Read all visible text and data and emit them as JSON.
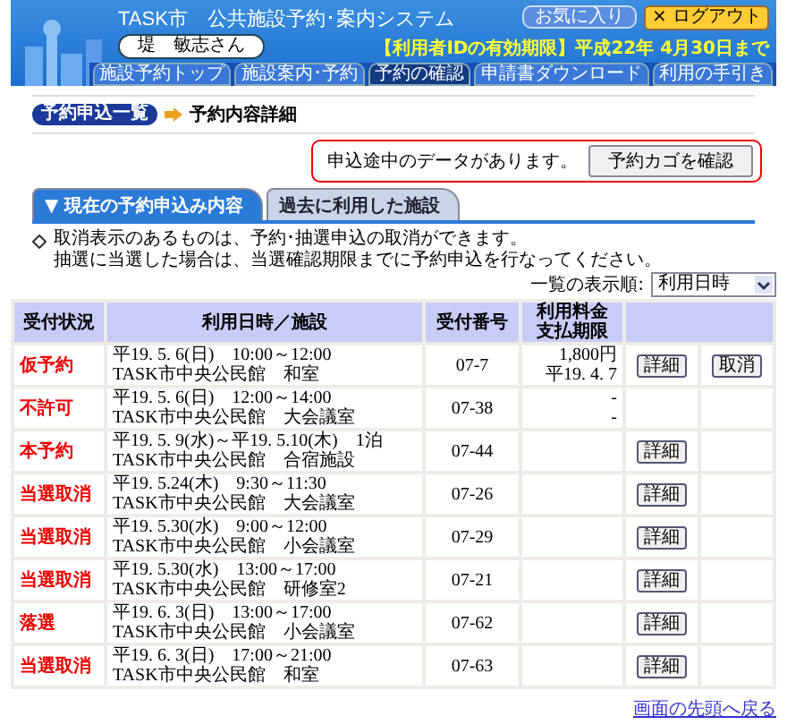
{
  "header": {
    "title": "TASK市　公共施設予約･案内システム",
    "user": "堤　敏志さん",
    "favorites_button": "お気に入り",
    "expiry": "【利用者IDの有効期限】平成22年 4月30日まで",
    "logout_button": "× ログアウト"
  },
  "nav": [
    {
      "label": "施設予約トップ",
      "selected": false
    },
    {
      "label": "施設案内･予約",
      "selected": false
    },
    {
      "label": "予約の確認",
      "selected": true
    },
    {
      "label": "申請書ダウンロード",
      "selected": false
    },
    {
      "label": "利用の手引き",
      "selected": false
    }
  ],
  "breadcrumb": {
    "link": "予約申込一覧",
    "current": "予約内容詳細"
  },
  "notice": {
    "message": "申込途中のデータがあります。",
    "button": "予約カゴを確認"
  },
  "tabs": [
    {
      "label": "▼ 現在の予約申込み内容",
      "selected": true
    },
    {
      "label": "過去に利用した施設",
      "selected": false
    }
  ],
  "notes": [
    "取消表示のあるものは、予約･抽選申込の取消ができます。",
    "抽選に当選した場合は、当選確認期限までに予約申込を行なってください。"
  ],
  "sort": {
    "label": "一覧の表示順:",
    "value": "利用日時"
  },
  "table": {
    "columns": [
      "受付状況",
      "利用日時／施設",
      "受付番号",
      "利用料金支払期限"
    ],
    "rows": [
      {
        "status": "仮予約",
        "date": "平19. 5. 6(日)　10:00～12:00",
        "facility": "TASK市中央公民館　和室",
        "number": "07-7",
        "fee": "1,800円",
        "due": "平19. 4. 7",
        "detail": "詳細",
        "cancel": "取消"
      },
      {
        "status": "不許可",
        "date": "平19. 5. 6(日)　12:00～14:00",
        "facility": "TASK市中央公民館　大会議室",
        "number": "07-38",
        "fee": "-",
        "due": "-"
      },
      {
        "status": "本予約",
        "date": "平19. 5. 9(水)～平19. 5.10(木)　1泊",
        "facility": "TASK市中央公民館　合宿施設",
        "number": "07-44",
        "detail": "詳細"
      },
      {
        "status": "当選取消",
        "date": "平19. 5.24(木)　9:30～11:30",
        "facility": "TASK市中央公民館　大会議室",
        "number": "07-26",
        "detail": "詳細"
      },
      {
        "status": "当選取消",
        "date": "平19. 5.30(水)　9:00～12:00",
        "facility": "TASK市中央公民館　小会議室",
        "number": "07-29",
        "detail": "詳細"
      },
      {
        "status": "当選取消",
        "date": "平19. 5.30(水)　13:00～17:00",
        "facility": "TASK市中央公民館　研修室2",
        "number": "07-21",
        "detail": "詳細"
      },
      {
        "status": "落選",
        "date": "平19. 6. 3(日)　13:00～17:00",
        "facility": "TASK市中央公民館　小会議室",
        "number": "07-62",
        "detail": "詳細"
      },
      {
        "status": "当選取消",
        "date": "平19. 6. 3(日)　17:00～21:00",
        "facility": "TASK市中央公民館　和室",
        "number": "07-63",
        "detail": "詳細"
      }
    ]
  },
  "back_link": "画面の先頭へ戻る"
}
